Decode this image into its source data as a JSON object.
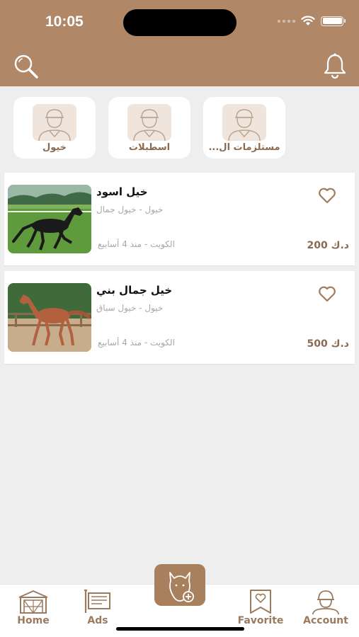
{
  "status_bar": {
    "time": "10:05"
  },
  "header": {
    "search_icon": "search-icon",
    "bell_icon": "bell-icon"
  },
  "colors": {
    "accent": "#b08868",
    "accent_text": "#8b6a4f",
    "background": "#eeeeee"
  },
  "categories": [
    {
      "label": "مستلزمات ال...",
      "icon": "user-avatar-icon"
    },
    {
      "label": "اسطبلات",
      "icon": "user-avatar-icon"
    },
    {
      "label": "خيول",
      "icon": "user-avatar-icon"
    }
  ],
  "listings": [
    {
      "title": "خيل اسود",
      "subtitle": "خيول - خيول جمال",
      "location": "الكويت - منذ 4 أسابيع",
      "price": "د.ك 200",
      "favorite": false,
      "photo": "black-horse-photo"
    },
    {
      "title": "خيل جمال بني",
      "subtitle": "خيول - خيول سباق",
      "location": "الكويت - منذ 4 أسابيع",
      "price": "د.ك 500",
      "favorite": false,
      "photo": "brown-horse-photo"
    }
  ],
  "tabbar": {
    "home": "Home",
    "ads": "Ads",
    "favorite": "Favorite",
    "account": "Account",
    "add_icon": "add-horse-icon"
  }
}
